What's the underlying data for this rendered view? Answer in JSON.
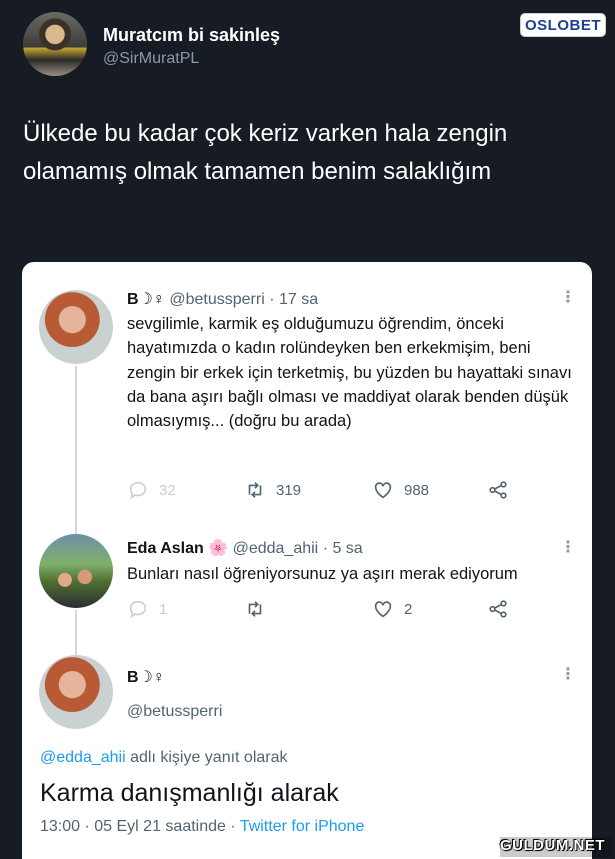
{
  "outer_tweet": {
    "author_name": "Muratcım bi sakinleş",
    "author_handle": "@SirMuratPL",
    "text": "Ülkede bu kadar çok keriz varken hala zengin olamamış olmak tamamen benim salaklığım"
  },
  "logo_text": "OSLOBET",
  "watermark_text": "GULDUM.NET",
  "quoted": {
    "tweet1": {
      "author_name": "B☽♀",
      "author_handle": "@betussperri",
      "time": "· 17 sa",
      "text": "sevgilimle, karmik eş olduğumuzu öğrendim, önceki hayatımızda o kadın rolündeyken ben erkekmişim, beni zengin bir erkek için terketmiş, bu yüzden bu hayattaki sınavı da bana aşırı bağlı olması ve maddiyat olarak benden düşük olmasıymış... (doğru bu arada)",
      "replies": "32",
      "retweets": "319",
      "likes": "988"
    },
    "tweet2": {
      "author_name": "Eda Aslan",
      "author_emoji": "🌸",
      "author_handle": "@edda_ahii",
      "time": "· 5 sa",
      "text": "Bunları nasıl öğreniyorsunuz ya aşırı merak ediyorum",
      "replies": "1",
      "retweets": "",
      "likes": "2"
    },
    "tweet3": {
      "author_name": "B☽♀",
      "author_handle": "@betussperri",
      "reply_to_mention": "@edda_ahii",
      "reply_to_suffix": "adlı kişiye yanıt olarak",
      "text": "Karma danışmanlığı alarak",
      "timestamp": "13:00 · 05 Eyl 21 saatinde ·",
      "source": "Twitter for iPhone"
    }
  },
  "colors": {
    "background": "#171c24",
    "card": "#ffffff",
    "link": "#1d9bf0",
    "muted": "#536471"
  }
}
